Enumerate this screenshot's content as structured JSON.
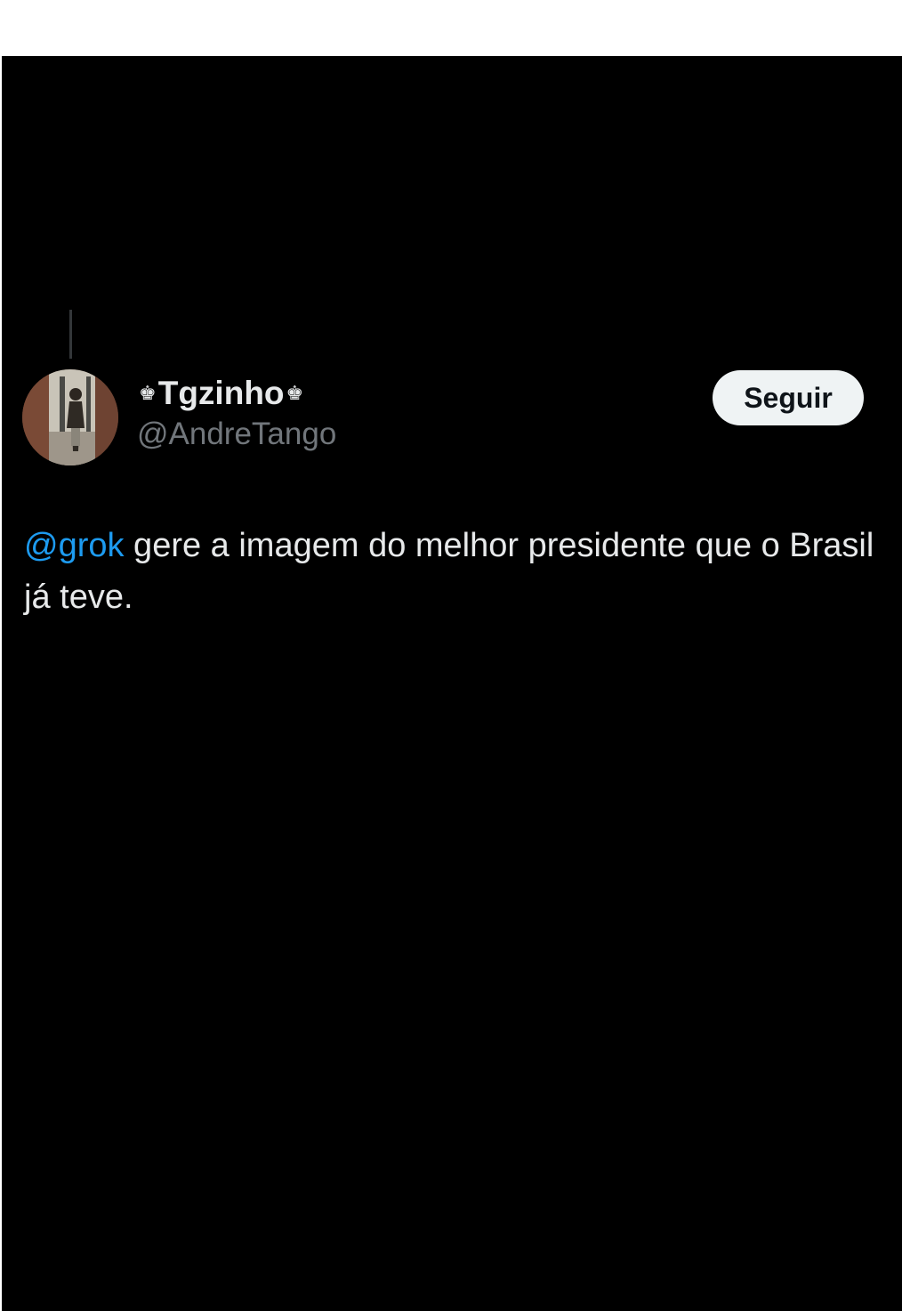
{
  "tweet": {
    "author": {
      "display_name": "Tgzinho",
      "name_prefix_emoji": "♚",
      "name_suffix_emoji": "♚",
      "handle": "@AndreTango",
      "avatar_icon": "avatar-photo"
    },
    "follow_button_label": "Seguir",
    "text": {
      "mention": "@grok",
      "body": " gere a imagem do melhor presidente que o Brasil já teve."
    }
  },
  "colors": {
    "background": "#000000",
    "primary_text": "#e7e9ea",
    "secondary_text": "#71767b",
    "link": "#1d9bf0",
    "button_bg": "#eff3f4",
    "button_text": "#0f1419"
  }
}
